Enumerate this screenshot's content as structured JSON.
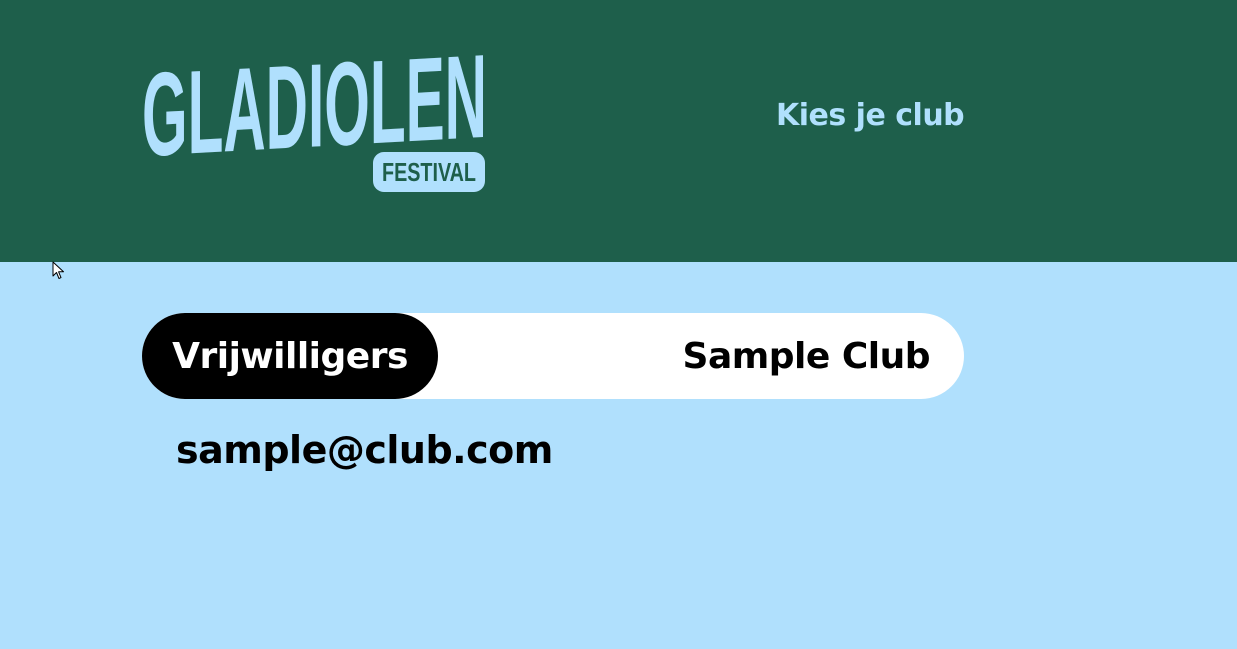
{
  "header": {
    "logo_main": "GLADIOLEN",
    "logo_sub": "FESTIVAL",
    "nav_link": "Kies je club"
  },
  "selector": {
    "active_tab": "Vrijwilligers",
    "club_name": "Sample Club"
  },
  "account": {
    "email": "sample@club.com"
  },
  "colors": {
    "header_bg": "#1e5f4b",
    "page_bg": "#b0e0fd",
    "accent_light": "#b0e0fd"
  },
  "icons": {
    "cursor": "mouse-pointer-icon"
  }
}
